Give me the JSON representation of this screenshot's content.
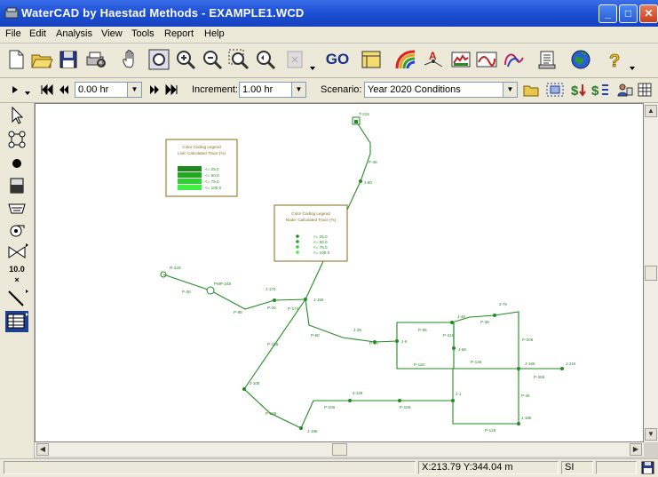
{
  "window": {
    "title": "WaterCAD by Haestad Methods - EXAMPLE1.WCD"
  },
  "menu": [
    "File",
    "Edit",
    "Analysis",
    "View",
    "Tools",
    "Report",
    "Help"
  ],
  "toolbar": {
    "go_label": "GO"
  },
  "timebar": {
    "time_value": "0.00 hr",
    "increment_label": "Increment:",
    "increment_value": "1.00 hr",
    "scenario_label": "Scenario:",
    "scenario_value": "Year 2020 Conditions"
  },
  "lefttoolbar": {
    "value_tool_label": "10.0"
  },
  "legend1": {
    "title": "Color Coding Legend",
    "subtitle": "Link: Calculated Trace (%)",
    "rows": [
      "<= 25.0",
      "<= 50.0",
      "<= 75.0",
      "<= 100.0"
    ],
    "colors": [
      "#1e8a1e",
      "#22a822",
      "#2ed42e",
      "#44ee44"
    ]
  },
  "legend2": {
    "title": "Color Coding Legend",
    "subtitle": "Node: Calculated Trace (%)",
    "rows": [
      "<= 25.0",
      "<= 50.0",
      "<= 75.0",
      "<= 100.0"
    ]
  },
  "network": {
    "labels": {
      "tank": "T-215",
      "p48": "P-48",
      "j80": "J-80",
      "p56": "P-56",
      "reservoir": "R-226",
      "pump": "PMP-245",
      "p30": "P-30",
      "p88": "P-88",
      "j170": "J-170",
      "p26": "P-26",
      "p174": "P-174",
      "j156": "J-156",
      "p156": "P-156",
      "p60": "P-60",
      "j36": "J-36",
      "p20": "P-20",
      "j6": "J-6",
      "p96": "P-96",
      "p216": "P-216",
      "j46": "J-46",
      "p36": "P-36",
      "j76": "J-76",
      "p206": "P-206",
      "j56": "J-56",
      "p116": "P-116",
      "p136": "P-136",
      "j166": "J-166",
      "j216": "J-216",
      "p256": "P-256",
      "p46": "P-46",
      "j106": "J-106",
      "j126": "J-126",
      "j1": "J-1",
      "j186": "J-186",
      "p186": "P-186",
      "p156b": "P-156",
      "p106": "P-106",
      "j196": "J-196",
      "p126": "P-126"
    }
  },
  "status": {
    "coords": "X:213.79  Y:344.04 m",
    "units": "SI"
  },
  "colors": {
    "network": "#228b22",
    "legend_border": "#8b6914"
  }
}
